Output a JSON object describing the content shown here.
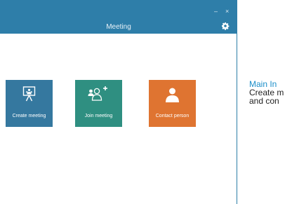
{
  "window": {
    "title": "Meeting",
    "controls": {
      "minimize": "–",
      "close": "×"
    },
    "settings_icon": "gear-icon"
  },
  "tiles": [
    {
      "label": "Create meeting",
      "icon": "presentation-board-icon",
      "color": "#35789f"
    },
    {
      "label": "Join meeting",
      "icon": "add-person-icon",
      "color": "#2f8f81"
    },
    {
      "label": "Contact person",
      "icon": "person-icon",
      "color": "#df7431"
    }
  ],
  "annotation": {
    "title": "Main In",
    "line1": "Create m",
    "line2": "and con"
  },
  "colors": {
    "titlebar": "#2e7ea9",
    "annotation_title": "#1a8ec9"
  }
}
